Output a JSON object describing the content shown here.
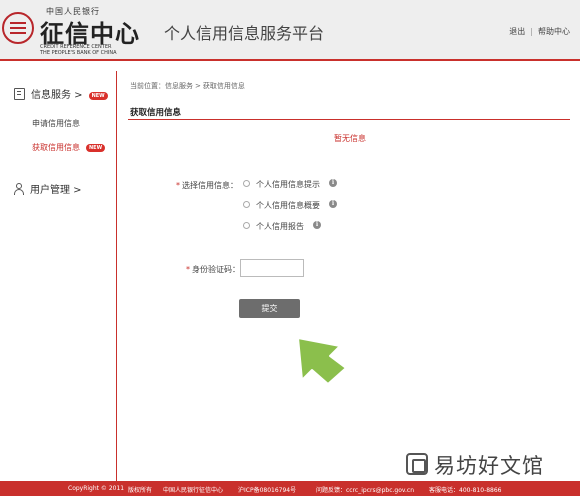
{
  "header": {
    "logo": {
      "top_text": "中国人民银行",
      "main_text": "征信中心",
      "en_line1": "CREDIT REFERENCE CENTER",
      "en_line2": "THE PEOPLE'S BANK OF CHINA"
    },
    "platform_title": "个人信用信息服务平台",
    "links": {
      "logout": "退出",
      "separator": "|",
      "help": "帮助中心"
    }
  },
  "sidebar": {
    "credit_service": {
      "label": "信息服务 >",
      "badge": "NEW",
      "icon": "document-icon"
    },
    "submenu": [
      {
        "label": "申请信用信息",
        "active": false
      },
      {
        "label": "获取信用信息",
        "active": true,
        "badge": "NEW"
      }
    ],
    "user_management": {
      "label": "用户管理 >",
      "icon": "user-icon"
    }
  },
  "main": {
    "breadcrumb": {
      "prefix": "当前位置：",
      "level1": "信息服务",
      "separator": ">",
      "level2": "获取信用信息"
    },
    "section_title": "获取信用信息",
    "no_info": "暂无信息",
    "form": {
      "select_label_required": "*",
      "select_label": "选择信用信息：",
      "options": [
        {
          "label": "个人信用信息提示",
          "info_icon": "i"
        },
        {
          "label": "个人信用信息概要",
          "info_icon": "i"
        },
        {
          "label": "个人信用报告",
          "info_icon": "i"
        }
      ],
      "id_code_required": "*",
      "id_code_label": "身份验证码：",
      "id_code_value": "",
      "submit_label": "提交"
    }
  },
  "footer": {
    "copyright": "CopyRight © 2011",
    "rights": "版权所有",
    "org": "中国人民银行征信中心",
    "icp": "沪ICP备08016794号",
    "feedback": "问题反馈：ccrc_ipcrs@pbc.gov.cn",
    "hotline": "客服电话：400-810-8866"
  },
  "watermark": {
    "text": "易坊好文馆"
  },
  "colors": {
    "brand_red": "#c9302c",
    "button_gray": "#6d6d6d",
    "arrow_green": "#8bbf4c"
  }
}
